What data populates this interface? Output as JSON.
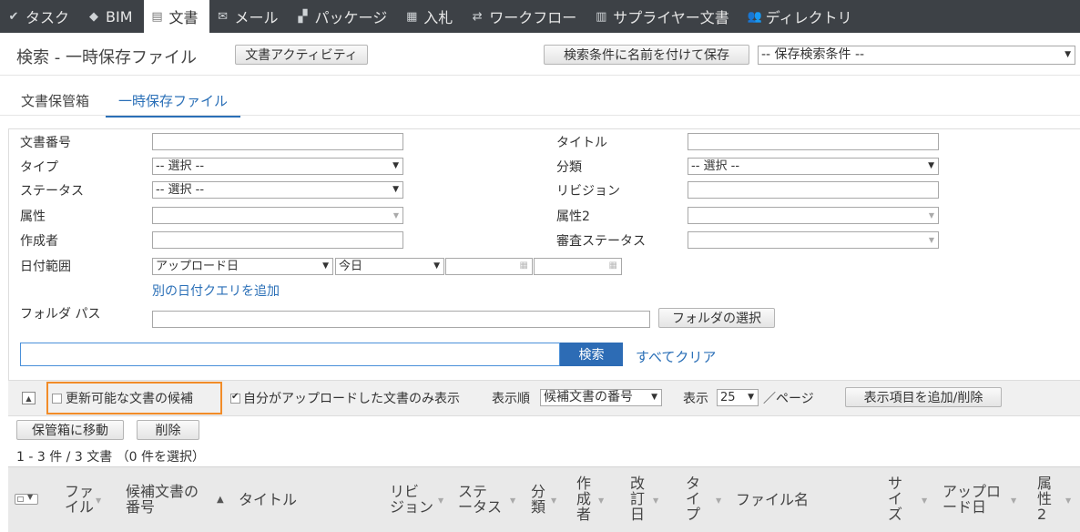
{
  "nav": {
    "items": [
      {
        "label": "タスク",
        "icon": "check-icon"
      },
      {
        "label": "BIM",
        "icon": "cube-icon"
      },
      {
        "label": "文書",
        "icon": "document-icon"
      },
      {
        "label": "メール",
        "icon": "envelope-icon"
      },
      {
        "label": "パッケージ",
        "icon": "package-icon"
      },
      {
        "label": "入札",
        "icon": "tender-icon"
      },
      {
        "label": "ワークフロー",
        "icon": "workflow-icon"
      },
      {
        "label": "サプライヤー文書",
        "icon": "building-icon"
      },
      {
        "label": "ディレクトリ",
        "icon": "people-icon"
      }
    ],
    "active": "文書"
  },
  "header": {
    "title": "検索 - 一時保存ファイル",
    "activity_button": "文書アクティビティ",
    "save_search_button": "検索条件に名前を付けて保存",
    "saved_search_select": "-- 保存検索条件 --"
  },
  "tabs": [
    {
      "label": "文書保管箱"
    },
    {
      "label": "一時保存ファイル"
    }
  ],
  "form": {
    "doc_number_label": "文書番号",
    "title_label": "タイトル",
    "type_label": "タイプ",
    "type_value": "-- 選択 --",
    "category_label": "分類",
    "category_value": "-- 選択 --",
    "status_label": "ステータス",
    "status_value": "-- 選択 --",
    "revision_label": "リビジョン",
    "attribute_label": "属性",
    "attribute2_label": "属性2",
    "author_label": "作成者",
    "review_status_label": "審査ステータス",
    "date_range_label": "日付範囲",
    "date_field_value": "アップロード日",
    "date_period_value": "今日",
    "add_date_query_link": "別の日付クエリを追加",
    "folder_path_label": "フォルダ パス",
    "folder_select_button": "フォルダの選択",
    "search_button": "検索",
    "clear_all_link": "すべてクリア"
  },
  "toolbar": {
    "update_candidates_label": "更新可能な文書の候補",
    "update_candidates_checked": false,
    "my_uploads_label": "自分がアップロードした文書のみ表示",
    "my_uploads_checked": true,
    "sort_label": "表示順",
    "sort_value": "候補文書の番号",
    "display_label": "表示",
    "per_page_value": "25",
    "per_page_suffix": "／ページ",
    "columns_button": "表示項目を追加/削除"
  },
  "actions": {
    "move_button": "保管箱に移動",
    "delete_button": "削除"
  },
  "results": {
    "count_text": "1 - 3 件 / 3 文書 （0 件を選択）"
  },
  "table": {
    "columns": [
      {
        "label": "ファ\nイル"
      },
      {
        "label": "候補文書の\n番号"
      },
      {
        "label": "タイトル"
      },
      {
        "label": "リビ\nジョン"
      },
      {
        "label": "ステ\nータス"
      },
      {
        "label": "分\n類"
      },
      {
        "label": "作\n成\n者"
      },
      {
        "label": "改\n訂\n日"
      },
      {
        "label": "タ\nイ\nプ"
      },
      {
        "label": "ファイル名"
      },
      {
        "label": "サ\nイ\nズ"
      },
      {
        "label": "アップロ\nード日"
      },
      {
        "label": "属\n性\n2"
      }
    ]
  }
}
